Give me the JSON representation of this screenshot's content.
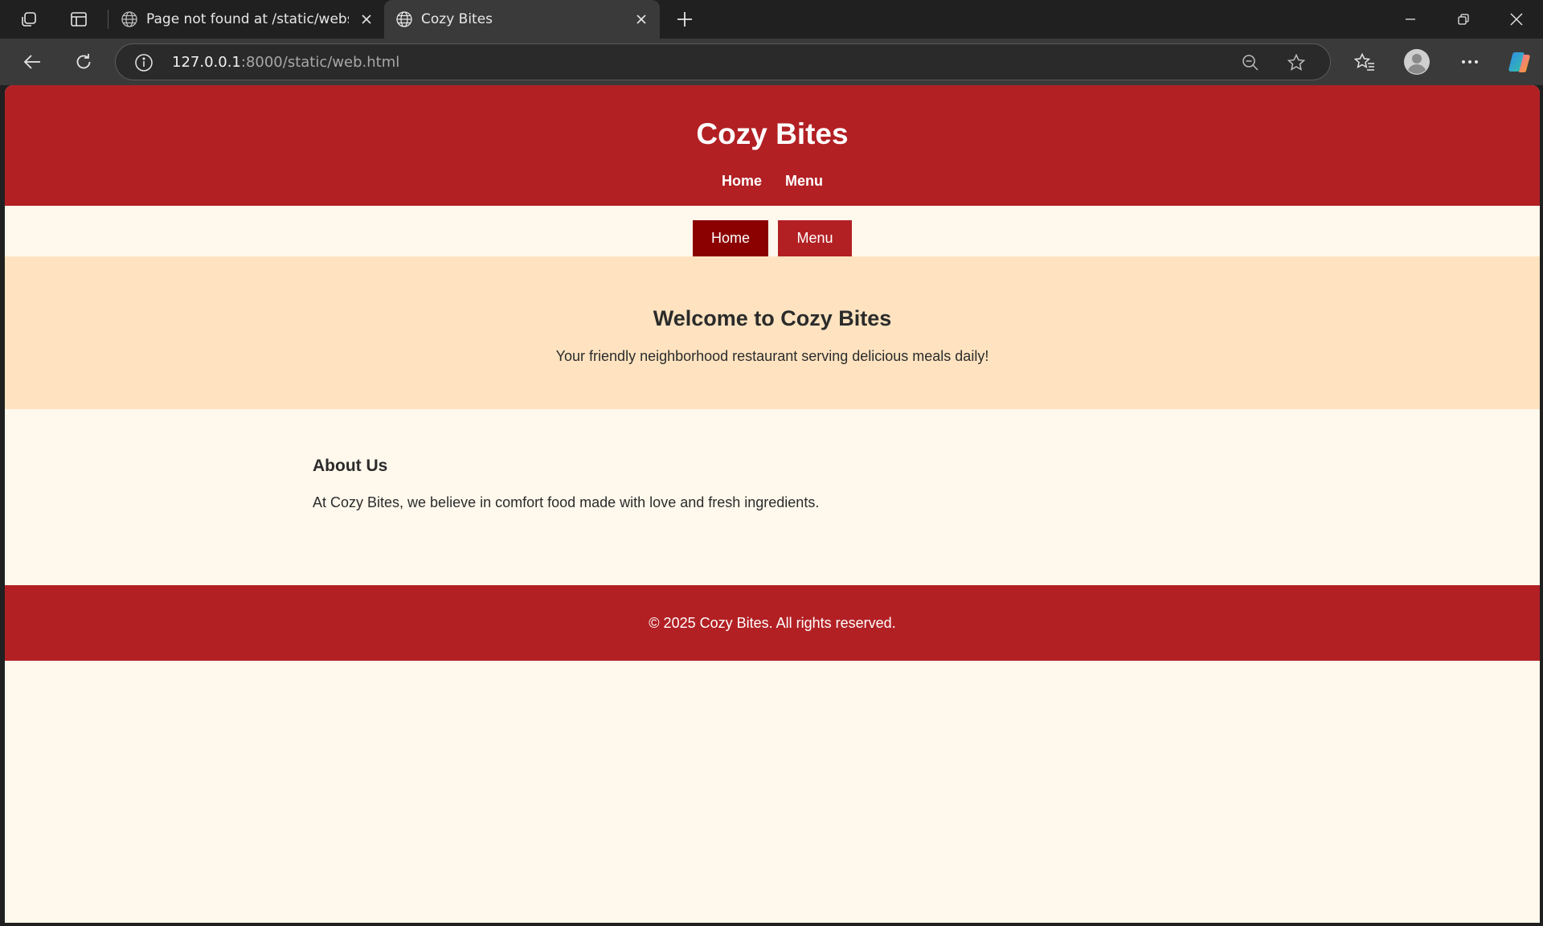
{
  "browser": {
    "tabs": [
      {
        "title": "Page not found at /static/website",
        "active": false
      },
      {
        "title": "Cozy Bites",
        "active": true
      }
    ],
    "address_host": "127.0.0.1",
    "address_rest": ":8000/static/web.html",
    "icons": [
      "workspaces-icon",
      "vertical-tabs-icon",
      "globe-icon",
      "close-icon",
      "new-tab-icon",
      "minimize-icon",
      "restore-icon",
      "window-close-icon",
      "back-icon",
      "refresh-icon",
      "site-info-icon",
      "zoom-out-icon",
      "favorite-star-icon",
      "favorites-icon",
      "profile-icon",
      "more-icon",
      "copilot-icon"
    ]
  },
  "site": {
    "title": "Cozy Bites",
    "nav": [
      "Home",
      "Menu"
    ],
    "buttons": {
      "home": "Home",
      "menu": "Menu"
    },
    "hero": {
      "heading": "Welcome to Cozy Bites",
      "tagline": "Your friendly neighborhood restaurant serving delicious meals daily!"
    },
    "about": {
      "heading": "About Us",
      "text": "At Cozy Bites, we believe in comfort food made with love and fresh ingredients."
    },
    "footer": "© 2025 Cozy Bites. All rights reserved."
  },
  "colors": {
    "header_red": "#b22024",
    "active_button": "#8b0000",
    "hero_bg": "#ffe3c0",
    "page_bg": "#fff8ec"
  }
}
